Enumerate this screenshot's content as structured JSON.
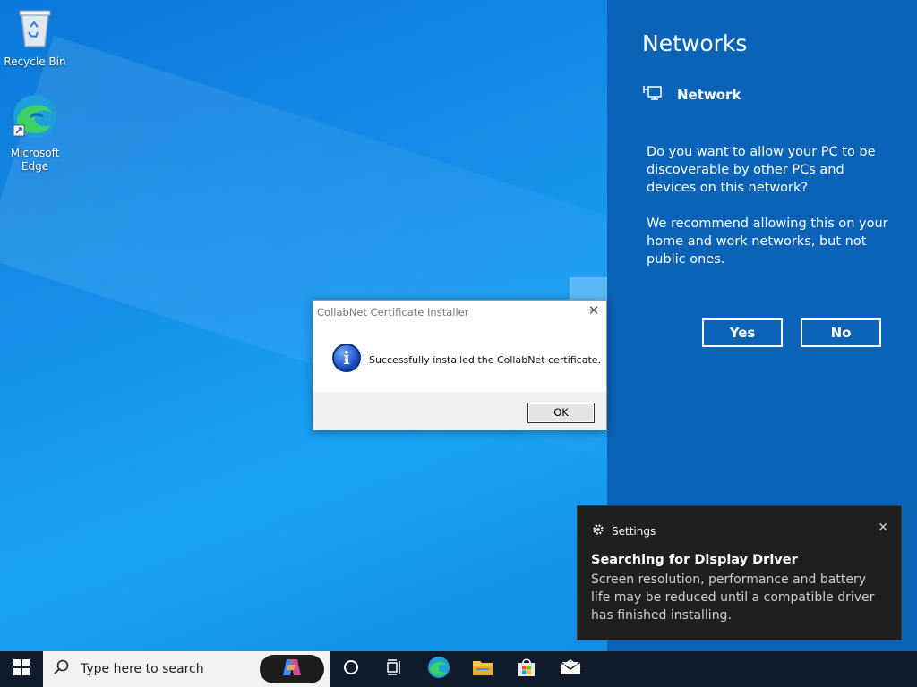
{
  "desktop": {
    "icons": [
      {
        "name": "recycle-bin",
        "label": "Recycle Bin"
      },
      {
        "name": "microsoft-edge",
        "label": "Microsoft Edge"
      }
    ]
  },
  "networks_panel": {
    "title": "Networks",
    "network_name": "Network",
    "question": "Do you want to allow your PC to be discoverable by other PCs and devices on this network?",
    "recommendation": "We recommend allowing this on your home and work networks, but not public ones.",
    "yes_label": "Yes",
    "no_label": "No",
    "background_color": "#0b63b8"
  },
  "dialog": {
    "title": "CollabNet Certificate Installer",
    "message": "Successfully installed the CollabNet certificate.",
    "ok_label": "OK",
    "close_glyph": "✕"
  },
  "toast": {
    "app": "Settings",
    "title": "Searching for Display Driver",
    "body": "Screen resolution, performance and battery life may be reduced until a compatible driver has finished installing.",
    "close_glyph": "✕"
  },
  "taskbar": {
    "search_placeholder": "Type here to search",
    "icons": [
      "windows-start-icon",
      "search-icon",
      "copilot-icon",
      "cortana-icon",
      "task-view-icon",
      "edge-icon",
      "file-explorer-icon",
      "store-icon",
      "mail-icon"
    ]
  }
}
